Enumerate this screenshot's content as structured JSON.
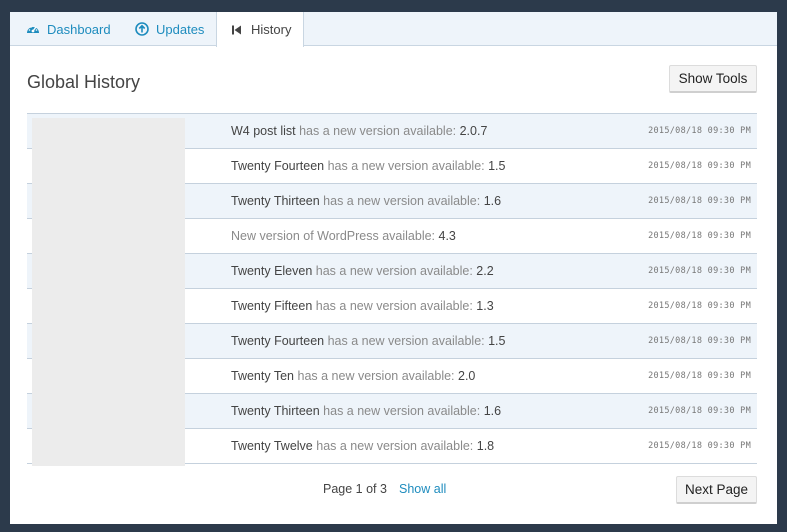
{
  "tabs": [
    {
      "label": "Dashboard",
      "icon": "dashboard-icon"
    },
    {
      "label": "Updates",
      "icon": "arrow-up-circle-icon"
    },
    {
      "label": "History",
      "icon": "skip-back-icon"
    }
  ],
  "title": "Global History",
  "show_tools_label": "Show Tools",
  "rows": [
    {
      "name": "W4 post list",
      "text": " has a new version available: ",
      "version": "2.0.7",
      "timestamp": "2015/08/18 09:30 PM"
    },
    {
      "name": "Twenty Fourteen",
      "text": " has a new version available: ",
      "version": "1.5",
      "timestamp": "2015/08/18 09:30 PM"
    },
    {
      "name": "Twenty Thirteen",
      "text": " has a new version available: ",
      "version": "1.6",
      "timestamp": "2015/08/18 09:30 PM"
    },
    {
      "name": "",
      "text": "New version of WordPress available: ",
      "version": "4.3",
      "timestamp": "2015/08/18 09:30 PM"
    },
    {
      "name": "Twenty Eleven",
      "text": " has a new version available: ",
      "version": "2.2",
      "timestamp": "2015/08/18 09:30 PM"
    },
    {
      "name": "Twenty Fifteen",
      "text": " has a new version available: ",
      "version": "1.3",
      "timestamp": "2015/08/18 09:30 PM"
    },
    {
      "name": "Twenty Fourteen",
      "text": " has a new version available: ",
      "version": "1.5",
      "timestamp": "2015/08/18 09:30 PM"
    },
    {
      "name": "Twenty Ten",
      "text": " has a new version available: ",
      "version": "2.0",
      "timestamp": "2015/08/18 09:30 PM"
    },
    {
      "name": "Twenty Thirteen",
      "text": " has a new version available: ",
      "version": "1.6",
      "timestamp": "2015/08/18 09:30 PM"
    },
    {
      "name": "Twenty Twelve",
      "text": " has a new version available: ",
      "version": "1.8",
      "timestamp": "2015/08/18 09:30 PM"
    }
  ],
  "pager": {
    "page_text": "Page 1 of 3",
    "show_all": "Show all",
    "next_label": "Next Page"
  },
  "colors": {
    "accent": "#1e8cbe",
    "background": "#2c3a4b",
    "row_alt": "#eef4fa"
  }
}
